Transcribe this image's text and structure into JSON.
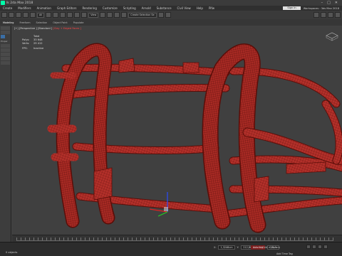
{
  "window": {
    "title": "lk 2da Max 2018"
  },
  "menu": {
    "items": [
      "Create",
      "Modifiers",
      "Animation",
      "Graph Editors",
      "Rendering",
      "Customize",
      "Scripting",
      "Arnold",
      "Substance",
      "Civil View",
      "Help",
      "Pifw"
    ],
    "sign_in": "Sign In",
    "workspaces": "Workspaces : 3ds Max 2018"
  },
  "toolbar": {
    "view_select": "View",
    "selection_set": "Create Selection Se"
  },
  "ribbon": {
    "tabs": [
      "Modeling",
      "Freeform",
      "Selection",
      "Object Paint",
      "Populate"
    ],
    "active_index": 0
  },
  "left_panel": {
    "label": "Proper"
  },
  "viewport": {
    "label_prefix": "[+] [Perspective ] [Standard ] ",
    "label_shading": "[Clay + Edged Faces ]",
    "stats": {
      "header": "Total",
      "polys_label": "Polys:",
      "polys_value": "33 648",
      "verts_label": "Verts:",
      "verts_value": "29 412",
      "fps_label": "FPS:",
      "fps_value": "Inactive"
    }
  },
  "status": {
    "selection": "0 objects",
    "x_label": "X:",
    "x_value": "1,3246cm",
    "y_label": "Y:",
    "y_value": "212,8639cm",
    "z_label": "Z:",
    "z_value": "0,0cm",
    "grid": "Grid = 10,0cm",
    "add_time_tag": "Add Time Tag",
    "auto_key": "Auto Key"
  },
  "colors": {
    "mesh": "#b3302a",
    "wire": "#5a0d08",
    "viewport_bg": "#404040",
    "panel_bg": "#3b3b3b"
  }
}
